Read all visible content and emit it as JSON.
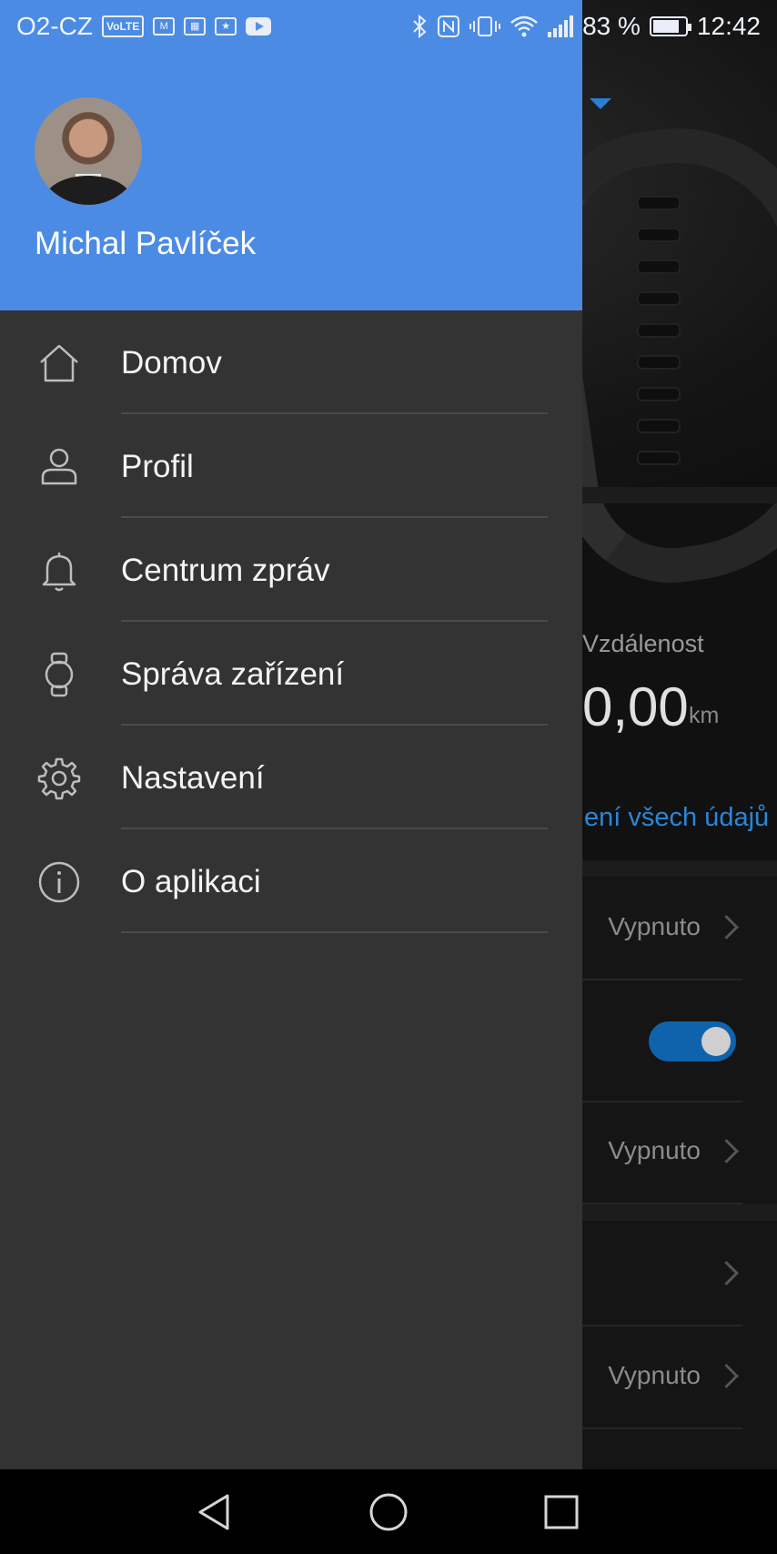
{
  "status_bar": {
    "carrier": "O2-CZ",
    "volte": "VoLTE",
    "battery_percent": "83 %",
    "battery_level": 0.83,
    "time": "12:42",
    "icons": [
      "volte-icon",
      "gmail-icon",
      "calendar-icon",
      "badge-icon",
      "youtube-icon",
      "bluetooth-icon",
      "nfc-icon",
      "vibrate-icon",
      "wifi-icon",
      "signal-icon",
      "battery-icon"
    ]
  },
  "drawer": {
    "user_name": "Michal Pavlíček",
    "items": [
      {
        "label": "Domov",
        "icon": "home-icon"
      },
      {
        "label": "Profil",
        "icon": "person-icon"
      },
      {
        "label": "Centrum zpráv",
        "icon": "bell-icon"
      },
      {
        "label": "Správa zařízení",
        "icon": "watch-icon"
      },
      {
        "label": "Nastavení",
        "icon": "gear-icon"
      },
      {
        "label": "O aplikaci",
        "icon": "info-icon"
      }
    ]
  },
  "background": {
    "stat_label": "Vzdálenost",
    "stat_value": "0,00",
    "stat_unit": "km",
    "link": "ení všech údajů",
    "rows": [
      {
        "value": "Vypnuto"
      },
      {
        "value": ""
      },
      {
        "value": "Vypnuto"
      },
      {
        "value": ""
      },
      {
        "value": "Vypnuto"
      }
    ],
    "toggle_on": true,
    "accent": "#2a86d8"
  },
  "colors": {
    "drawer_header": "#4c8be3",
    "drawer_bg": "#333333",
    "toggle": "#0f63ad"
  },
  "navbar": {
    "icons": [
      "back-icon",
      "home-circle-icon",
      "recents-icon"
    ]
  }
}
